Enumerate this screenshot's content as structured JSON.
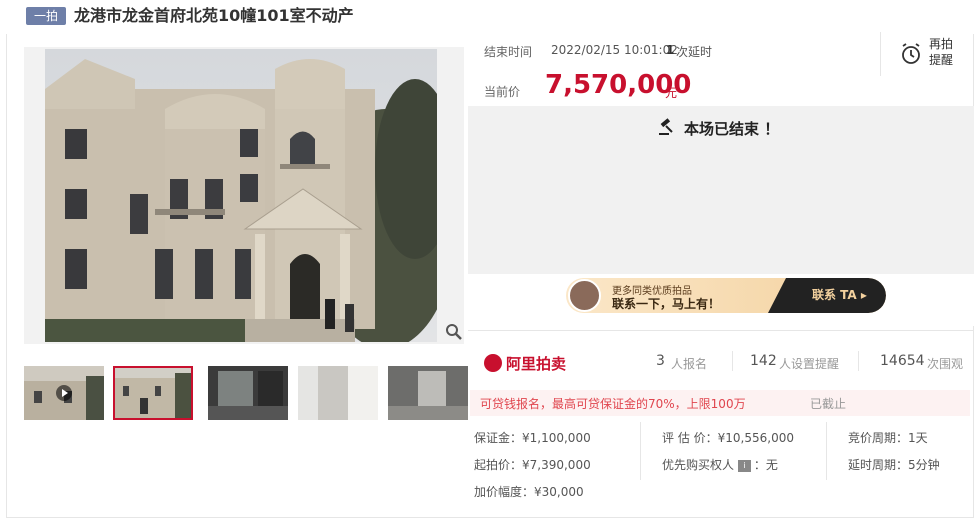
{
  "header": {
    "tag": "一拍",
    "title": "龙港市龙金首府北苑10幢101室不动产"
  },
  "auction": {
    "end_time_label": "结束时间",
    "end_time_value": "2022/02/15 10:01:02",
    "delay_count": "1",
    "delay_label": "次延时",
    "current_price_label": "当前价",
    "current_price": "7,570,000",
    "currency_unit": "元",
    "remind_label": "再拍提醒",
    "status": "本场已结束 ！"
  },
  "promo": {
    "line1": "更多同类优质拍品",
    "line2": "联系一下，马上有！",
    "button": "联系 TA"
  },
  "stats": {
    "brand": "阿里拍卖",
    "signups": "3",
    "signups_label": "人报名",
    "reminders": "142",
    "reminders_label": "人设置提醒",
    "views": "14654",
    "views_label": "次围观"
  },
  "notice": {
    "text": "可贷钱报名，最高可贷保证金的70%，上限100万",
    "status": "已截止"
  },
  "details": {
    "deposit": "保证金：¥1,100,000",
    "starting_price": "起拍价：¥7,390,000",
    "increment": "加价幅度：¥30,000",
    "appraisal": "评 估 价：¥10,556,000",
    "priority_buyer_label": "优先购买权人",
    "priority_buyer_value": "：无",
    "auction_period": "竞价周期：1天",
    "extension_period": "延时周期：5分钟"
  },
  "icons": {
    "zoom": "zoom-icon",
    "alarm": "alarm-clock-icon",
    "gavel": "gavel-icon",
    "play": "play-icon"
  },
  "colors": {
    "accent": "#c8102e",
    "tag_bg": "#6e7fa8"
  }
}
